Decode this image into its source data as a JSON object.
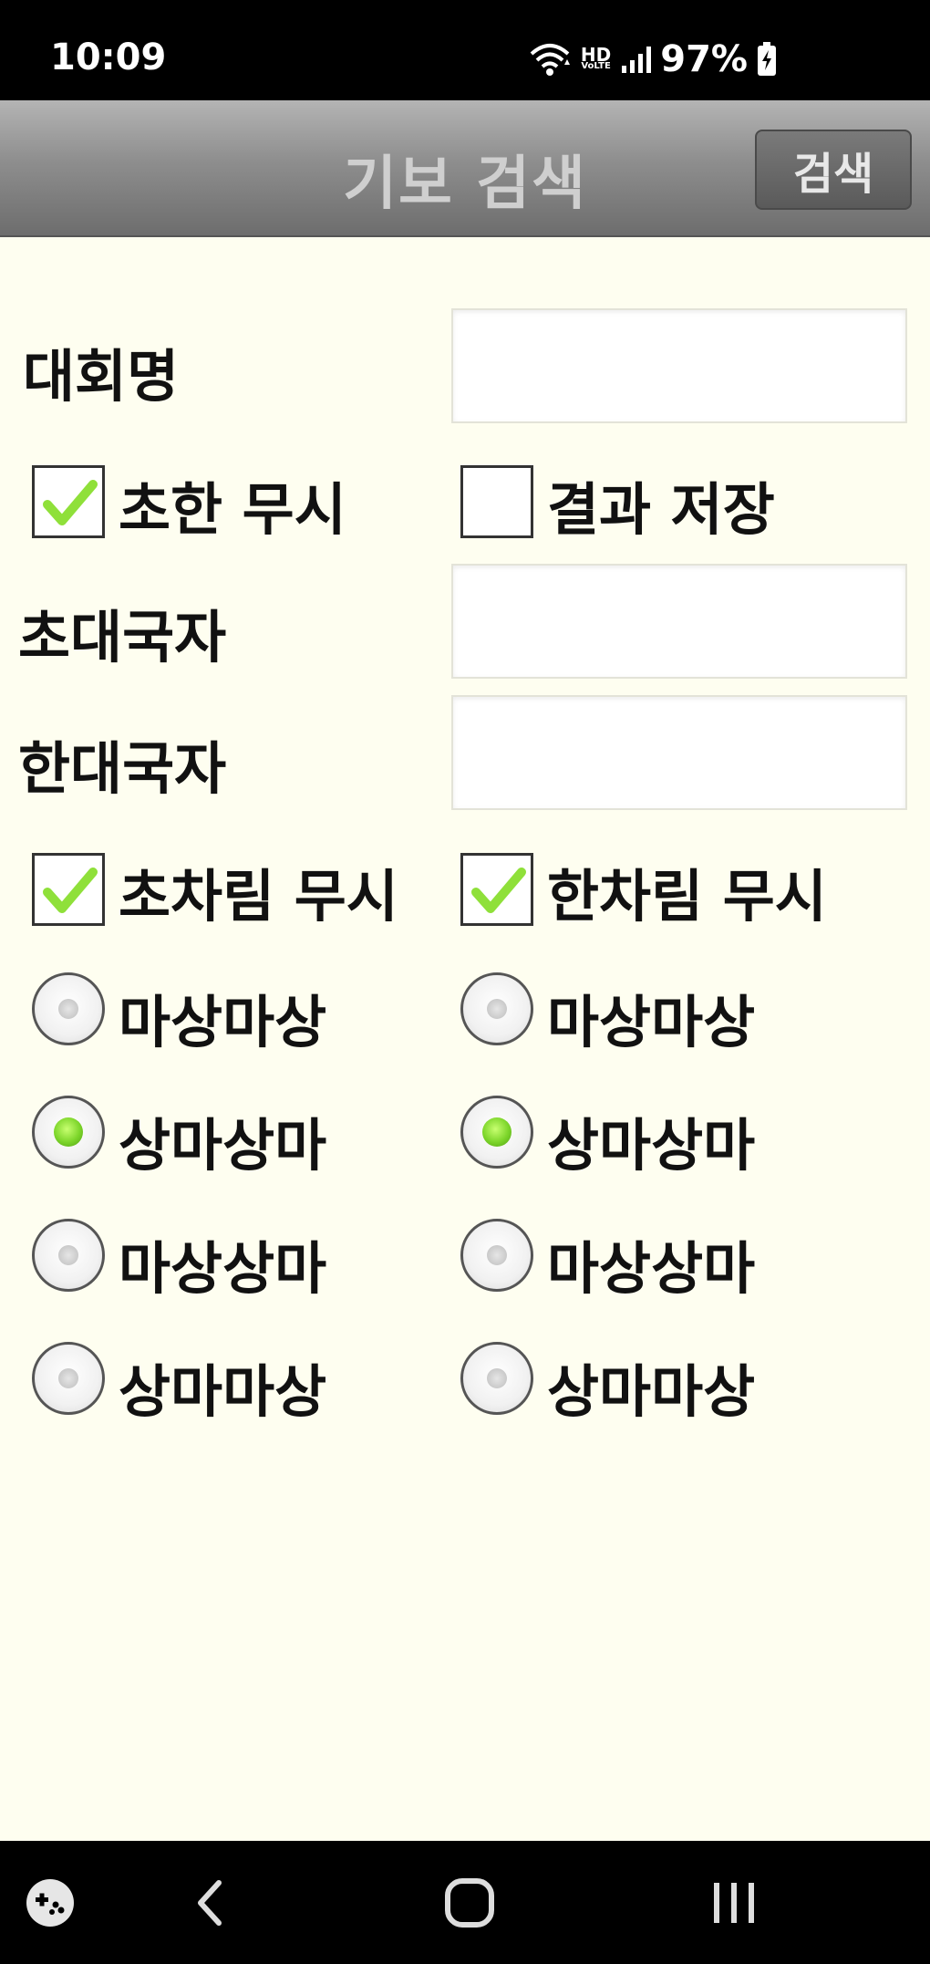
{
  "status_bar": {
    "time": "10:09",
    "hd_label": "HD",
    "volte_label": "VoLTE",
    "battery": "97%",
    "icons": [
      "wifi-icon",
      "signal-icon",
      "battery-charging-icon"
    ]
  },
  "header": {
    "title": "기보 검색",
    "search_button": "검색"
  },
  "form": {
    "tournament_label": "대회명",
    "tournament_value": "",
    "ignore_cho_han": {
      "label": "초한 무시",
      "checked": true
    },
    "save_result": {
      "label": "결과 저장",
      "checked": false
    },
    "cho_player_label": "초대국자",
    "cho_player_value": "",
    "han_player_label": "한대국자",
    "han_player_value": "",
    "ignore_cho_setup": {
      "label": "초차림 무시",
      "checked": true
    },
    "ignore_han_setup": {
      "label": "한차림 무시",
      "checked": true
    },
    "cho_setups": [
      {
        "label": "마상마상",
        "selected": false
      },
      {
        "label": "상마상마",
        "selected": true
      },
      {
        "label": "마상상마",
        "selected": false
      },
      {
        "label": "상마마상",
        "selected": false
      }
    ],
    "han_setups": [
      {
        "label": "마상마상",
        "selected": false
      },
      {
        "label": "상마상마",
        "selected": true
      },
      {
        "label": "마상상마",
        "selected": false
      },
      {
        "label": "상마마상",
        "selected": false
      }
    ]
  },
  "nav_bar": {
    "icons": [
      "game-tools-icon",
      "back-icon",
      "home-icon",
      "recents-icon"
    ]
  },
  "colors": {
    "background": "#fefef0",
    "accent_green": "#7cd52a",
    "header_gray": "#8e8e8e"
  }
}
